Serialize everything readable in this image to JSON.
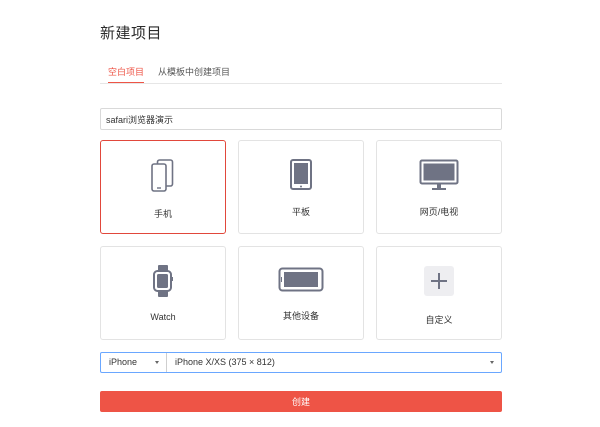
{
  "page": {
    "title": "新建项目"
  },
  "tabs": [
    {
      "label": "空白项目",
      "active": true
    },
    {
      "label": "从模板中创建项目",
      "active": false
    }
  ],
  "project_name": {
    "value": "safari浏览器演示",
    "placeholder": ""
  },
  "device_cards": [
    {
      "label": "手机",
      "icon": "phone-icon",
      "selected": true
    },
    {
      "label": "平板",
      "icon": "tablet-icon",
      "selected": false
    },
    {
      "label": "网页/电视",
      "icon": "monitor-icon",
      "selected": false
    },
    {
      "label": "Watch",
      "icon": "watch-icon",
      "selected": false
    },
    {
      "label": "其他设备",
      "icon": "landscape-device-icon",
      "selected": false
    },
    {
      "label": "自定义",
      "icon": "plus-icon",
      "selected": false
    }
  ],
  "device_select": {
    "selected": "iPhone"
  },
  "size_select": {
    "selected": "iPhone X/XS (375 × 812)"
  },
  "create_button": {
    "label": "创建"
  },
  "colors": {
    "accent": "#ee5446",
    "icon_gray": "#6f7384",
    "focus_border": "#6aa7ff"
  }
}
